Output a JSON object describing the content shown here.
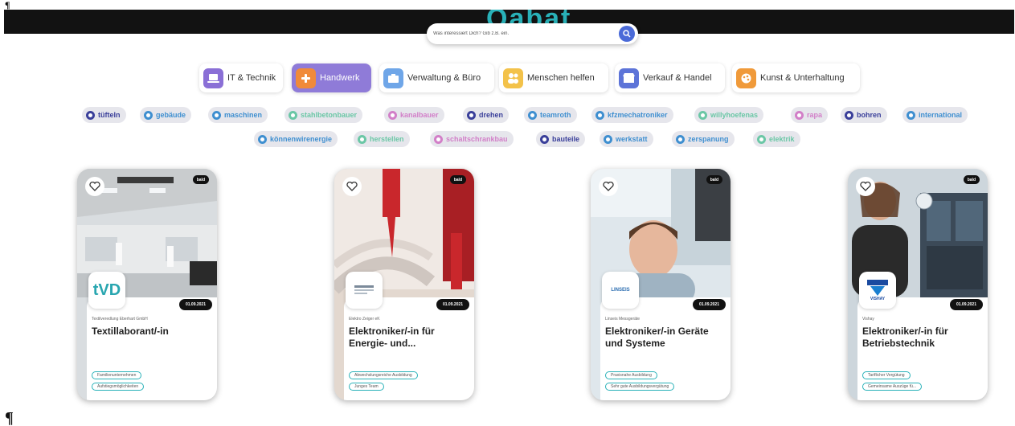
{
  "brand": {
    "title": "Qabat"
  },
  "search": {
    "placeholder": "Was interessiert Dich? Gib z.B. ein."
  },
  "categories": [
    {
      "label": "IT & Technik",
      "icon": "laptop-icon",
      "color": "#8a6fd6"
    },
    {
      "label": "Handwerk",
      "icon": "tools-icon",
      "color": "#f08a3a"
    },
    {
      "label": "Verwaltung & Büro",
      "icon": "office-icon",
      "color": "#6fa6e8"
    },
    {
      "label": "Menschen helfen",
      "icon": "people-icon",
      "color": "#f3c24a"
    },
    {
      "label": "Verkauf & Handel",
      "icon": "shop-icon",
      "color": "#5d74d8"
    },
    {
      "label": "Kunst & Unterhaltung",
      "icon": "art-icon",
      "color": "#f09a3a"
    }
  ],
  "tags_row1": [
    {
      "label": "tüfteln",
      "color": "#3a3f9a"
    },
    {
      "label": "gebäude",
      "color": "#3f8fd0"
    },
    {
      "label": "maschinen",
      "color": "#3f8fd0"
    },
    {
      "label": "stahlbetonbauer",
      "color": "#6bc7a6"
    },
    {
      "label": "kanalbauer",
      "color": "#d27fc8"
    },
    {
      "label": "drehen",
      "color": "#3a3f9a"
    },
    {
      "label": "teamroth",
      "color": "#3f8fd0"
    },
    {
      "label": "kfzmechatroniker",
      "color": "#3f8fd0"
    },
    {
      "label": "willyhoefenas",
      "color": "#6bc7a6"
    },
    {
      "label": "rapa",
      "color": "#d27fc8"
    },
    {
      "label": "bohren",
      "color": "#3a3f9a"
    },
    {
      "label": "international",
      "color": "#3f8fd0"
    }
  ],
  "tags_row2": [
    {
      "label": "könnenwirenergie",
      "color": "#3f8fd0"
    },
    {
      "label": "herstellen",
      "color": "#6bc7a6"
    },
    {
      "label": "schaltschrankbau",
      "color": "#d27fc8"
    },
    {
      "label": "bauteile",
      "color": "#3a3f9a"
    },
    {
      "label": "werkstatt",
      "color": "#3f8fd0"
    },
    {
      "label": "zerspanung",
      "color": "#3f8fd0"
    },
    {
      "label": "elektrik",
      "color": "#6bc7a6"
    }
  ],
  "cards": [
    {
      "badge": "bald",
      "date": "01.09.2021",
      "company": "Textilveredlung Eberhart GmbH",
      "title": "Textillaborant/-in",
      "logo_text": "tVD",
      "pills": [
        "Familienunternehmen",
        "Aufstiegsmöglichkeiten"
      ]
    },
    {
      "badge": "bald",
      "date": "01.09.2021",
      "company": "Elektro Zeiger eK",
      "title": "Elektroniker/-in für Energie- und...",
      "logo_text": "",
      "pills": [
        "Abwechslungsreiche Ausbildung",
        "Junges Team"
      ]
    },
    {
      "badge": "bald",
      "date": "01.09.2021",
      "company": "Linseis Messgeräte",
      "title": "Elektroniker/-in Geräte und Systeme",
      "logo_text": "LINSEIS",
      "pills": [
        "Praxisnahe Ausbildung",
        "Sehr gute Ausbildungsvergütung"
      ]
    },
    {
      "badge": "bald",
      "date": "01.09.2021",
      "company": "Vishay",
      "title": "Elektroniker/-in für Betriebstechnik",
      "logo_text": "VISHAY",
      "pills": [
        "Tariflicher Vergütung",
        "Gemeinsame Auszüge fü..."
      ]
    }
  ]
}
